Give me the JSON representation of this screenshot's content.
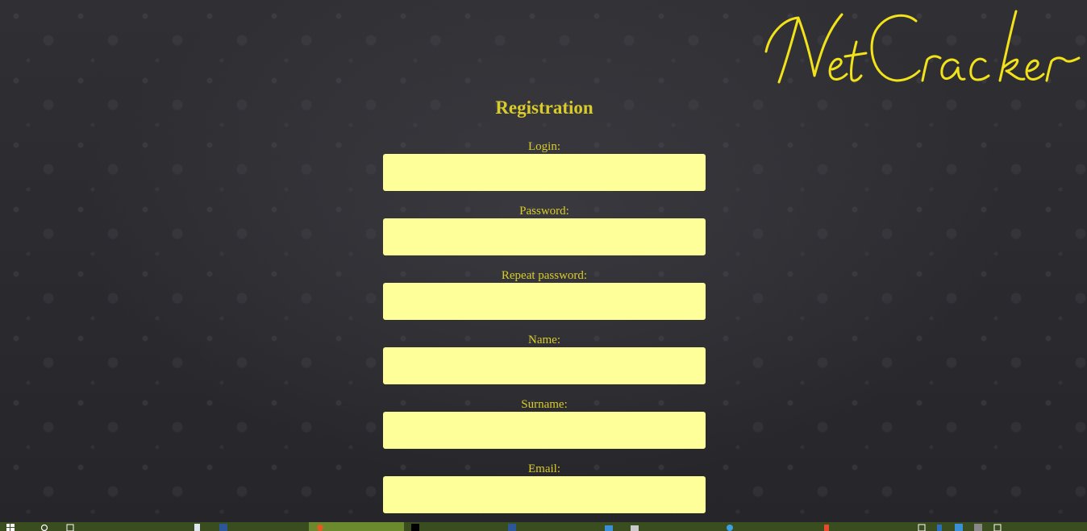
{
  "logo": {
    "text": "NetCracker"
  },
  "form": {
    "title": "Registration",
    "fields": [
      {
        "label": "Login:",
        "value": "",
        "placeholder": ""
      },
      {
        "label": "Password:",
        "value": "",
        "placeholder": ""
      },
      {
        "label": "Repeat password:",
        "value": "",
        "placeholder": ""
      },
      {
        "label": "Name:",
        "value": "",
        "placeholder": ""
      },
      {
        "label": "Surname:",
        "value": "",
        "placeholder": ""
      },
      {
        "label": "Email:",
        "value": "",
        "placeholder": ""
      }
    ]
  },
  "colors": {
    "accent_text": "#d9cc2a",
    "input_background": "#ffff99",
    "logo": "#f2e21a",
    "taskbar": "#3a4d1f"
  },
  "taskbar": {
    "start_icon": "windows-icon",
    "search_icon": "search-icon",
    "items": [
      {
        "icon": "task-view-icon"
      },
      {
        "icon": "document-icon"
      },
      {
        "icon": "word-icon"
      },
      {
        "icon": "browser-icon",
        "active": true
      },
      {
        "icon": "intellij-icon"
      },
      {
        "icon": "word-icon"
      },
      {
        "icon": "app-icon"
      },
      {
        "icon": "folder-icon"
      },
      {
        "icon": "chat-icon"
      },
      {
        "icon": "tool-icon"
      }
    ]
  }
}
